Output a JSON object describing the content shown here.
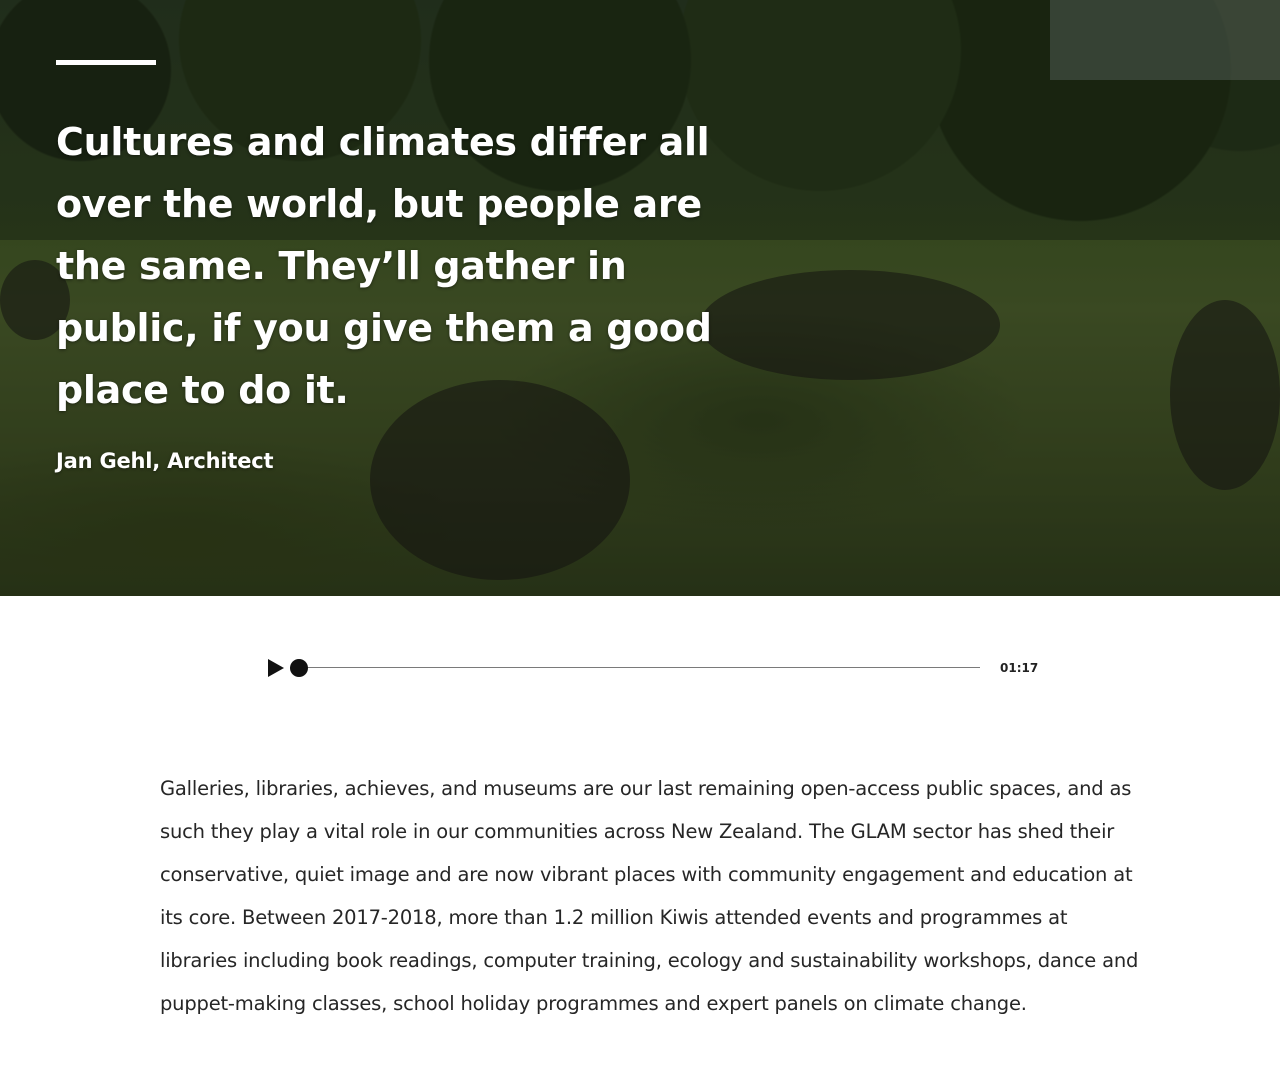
{
  "hero": {
    "quote": "Cultures and climates differ all over the world, but people are the same. They’ll gather in public, if you give them a good place to do it.",
    "author": "Jan Gehl, Architect",
    "image_subject": "people-picnicking-in-park"
  },
  "audio_player": {
    "current_time": "01:17",
    "progress_fraction": 0.0,
    "play_icon": "play-icon"
  },
  "article": {
    "paragraph": "Galleries, libraries, achieves, and museums are our last remaining open-access public spaces, and as such they play a vital role in our communities across New Zealand. The GLAM sector has shed their conservative, quiet image and are now vibrant places with community engagement and education at its core. Between 2017-2018, more than 1.2 million Kiwis attended events and programmes at libraries including book readings, computer training, ecology and sustainability workshops, dance and puppet-making classes, school holiday programmes and expert panels on climate change."
  }
}
